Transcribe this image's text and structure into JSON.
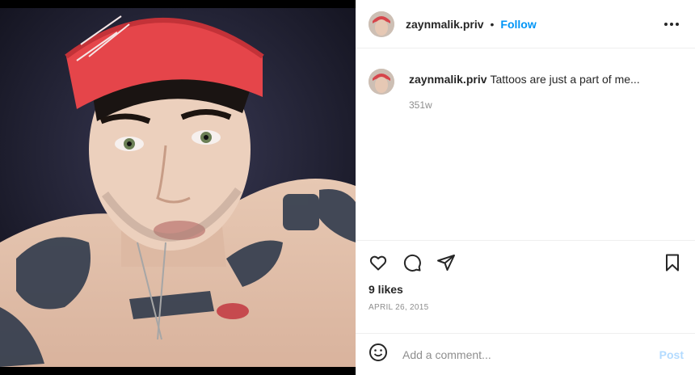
{
  "post": {
    "image_description_icon": "photo",
    "author": {
      "username": "zaynmalik.priv",
      "follow_label": "Follow",
      "separator": "•"
    },
    "caption": {
      "username": "zaynmalik.priv",
      "text": "Tattoos are just a part of me...",
      "age": "351w"
    },
    "actions": {
      "like_icon": "heart-icon",
      "comment_icon": "comment-icon",
      "share_icon": "send-icon",
      "save_icon": "bookmark-icon"
    },
    "likes": "9 likes",
    "date": "APRIL 26, 2015",
    "add_comment": {
      "placeholder": "Add a comment...",
      "post_label": "Post"
    }
  },
  "colors": {
    "accent": "#0095f6",
    "post_disabled": "#b3dbff",
    "text": "#262626",
    "muted": "#8e8e8e",
    "divider": "#efefef"
  }
}
